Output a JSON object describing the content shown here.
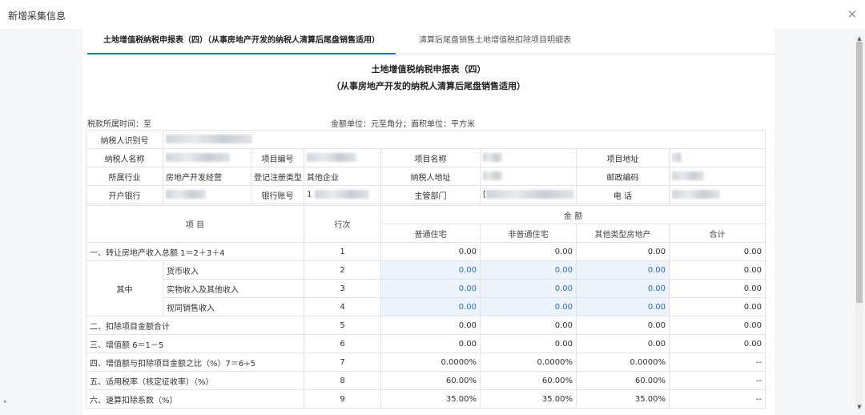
{
  "window": {
    "title": "新增采集信息"
  },
  "tabs": [
    {
      "label": "土地增值税纳税申报表（四）（从事房地产开发的纳税人清算后尾盘销售适用）"
    },
    {
      "label": "清算后尾盘销售土地增值税扣除项目明细表"
    }
  ],
  "form": {
    "title": "土地增值税纳税申报表（四）",
    "subtitle": "（从事房地产开发的纳税人清算后尾盘销售适用）",
    "period_label": "税款所属时间：至",
    "unit_label": "金额单位：元至角分；面积单位：平方米"
  },
  "info": {
    "taxpayer_id_label": "纳税人识别号",
    "taxpayer_name_label": "纳税人名称",
    "project_no_label": "项目编号",
    "project_name_label": "项目名称",
    "project_addr_label": "项目地址",
    "industry_label": "所属行业",
    "industry_value": "房地产开发经营",
    "reg_type_label": "登记注册类型",
    "reg_type_value": "其他企业",
    "taxpayer_addr_label": "纳税人地址",
    "postcode_label": "邮政编码",
    "bank_label": "开户银行",
    "account_label": "银行账号",
    "account_prefix": "1",
    "authority_label": "主管部门",
    "authority_prefix": "[",
    "phone_label": "电 话"
  },
  "grid": {
    "col_item": "项 目",
    "col_line": "行次",
    "col_amount": "金 额",
    "col_ordinary": "普通住宅",
    "col_nonordinary": "非普通住宅",
    "col_other": "其他类型房地产",
    "col_total": "合计",
    "group_label": "其中",
    "rows": [
      {
        "item": "一、转让房地产收入总额 1＝2＋3＋4",
        "line": "1",
        "v1": "0.00",
        "v2": "0.00",
        "v3": "0.00",
        "v4": "0.00"
      },
      {
        "item": "货币收入",
        "line": "2",
        "v1": "0.00",
        "v2": "0.00",
        "v3": "0.00",
        "v4": "0.00"
      },
      {
        "item": "实物收入及其他收入",
        "line": "3",
        "v1": "0.00",
        "v2": "0.00",
        "v3": "0.00",
        "v4": "0.00"
      },
      {
        "item": "视同销售收入",
        "line": "4",
        "v1": "0.00",
        "v2": "0.00",
        "v3": "0.00",
        "v4": "0.00"
      },
      {
        "item": "二、扣除项目金额合计",
        "line": "5",
        "v1": "0.00",
        "v2": "0.00",
        "v3": "0.00",
        "v4": "0.00"
      },
      {
        "item": "三、增值额 6＝1－5",
        "line": "6",
        "v1": "0.00",
        "v2": "0.00",
        "v3": "0.00",
        "v4": "0.00"
      },
      {
        "item": "四、增值额与扣除项目金额之比（%）7＝6÷5",
        "line": "7",
        "v1": "0.0000%",
        "v2": "0.0000%",
        "v3": "0.0000%",
        "v4": "--"
      },
      {
        "item": "五、适用税率（核定征收率）（%）",
        "line": "8",
        "v1": "60.00%",
        "v2": "60.00%",
        "v3": "60.00%",
        "v4": "--"
      },
      {
        "item": "六、速算扣除系数（%）",
        "line": "9",
        "v1": "35.00%",
        "v2": "35.00%",
        "v3": "35.00%",
        "v4": "--"
      }
    ]
  },
  "colors": {
    "accent": "#1e6fd9",
    "editable_bg": "#eef4fc",
    "editable_text": "#2a6bc9"
  },
  "icons": {
    "close": "close-icon",
    "scroll_up": "scroll-up-icon",
    "scroll_down": "scroll-down-icon"
  }
}
